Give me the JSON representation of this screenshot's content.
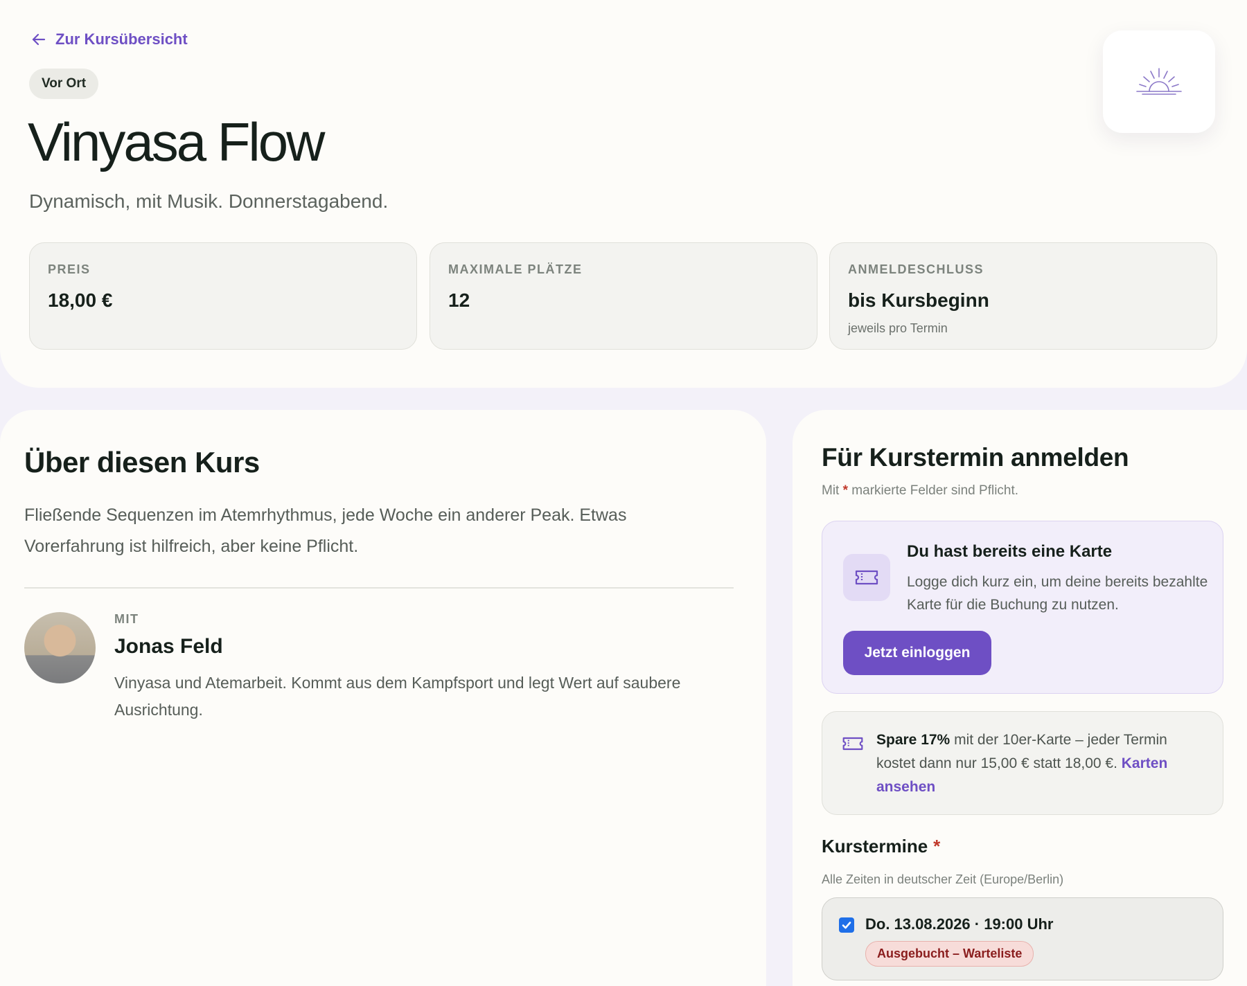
{
  "nav": {
    "back_label": "Zur Kursübersicht"
  },
  "course": {
    "venue_badge": "Vor Ort",
    "title": "Vinyasa Flow",
    "subtitle": "Dynamisch, mit Musik. Donnerstagabend."
  },
  "stats": [
    {
      "label": "PREIS",
      "value": "18,00 €",
      "note": ""
    },
    {
      "label": "MAXIMALE PLÄTZE",
      "value": "12",
      "note": ""
    },
    {
      "label": "ANMELDESCHLUSS",
      "value": "bis Kursbeginn",
      "note": "jeweils pro Termin"
    }
  ],
  "about": {
    "title": "Über diesen Kurs",
    "text": "Fließende Sequenzen im Atemrhythmus, jede Woche ein anderer Peak. Etwas Vorerfahrung ist hilfreich, aber keine Pflicht."
  },
  "teacher": {
    "kicker": "MIT",
    "name": "Jonas Feld",
    "bio": "Vinyasa und Atemarbeit. Kommt aus dem Kampfsport und legt Wert auf saubere Ausrichtung."
  },
  "booking": {
    "title": "Für Kurstermin anmelden",
    "required_prefix": "Mit",
    "required_star": "*",
    "required_suffix": "markierte Felder sind Pflicht.",
    "card": {
      "heading": "Du hast bereits eine Karte",
      "text": "Logge dich kurz ein, um deine bereits bezahlte Karte für die Buchung zu nutzen.",
      "button": "Jetzt einloggen"
    },
    "savings": {
      "bold": "Spare 17%",
      "text": "mit der 10er-Karte – jeder Termin kostet dann nur 15,00 € statt 18,00 €.",
      "link": "Karten ansehen"
    },
    "dates": {
      "heading": "Kurstermine",
      "star": "*",
      "tz_note": "Alle Zeiten in deutscher Zeit (Europe/Berlin)",
      "options": [
        {
          "label": "Do. 13.08.2026 · 19:00 Uhr",
          "status": "Ausgebucht – Warteliste",
          "checked": true
        }
      ]
    }
  },
  "colors": {
    "accent": "#6e4fc4",
    "page_bg": "#fdfcf9",
    "outer_bg": "#f3f1f9",
    "waitlist_text": "#8a1d1d",
    "required_star": "#c0392b"
  },
  "icons": [
    "arrow-left-icon",
    "sunrise-logo-icon",
    "ticket-icon",
    "checkbox-checked-icon"
  ]
}
